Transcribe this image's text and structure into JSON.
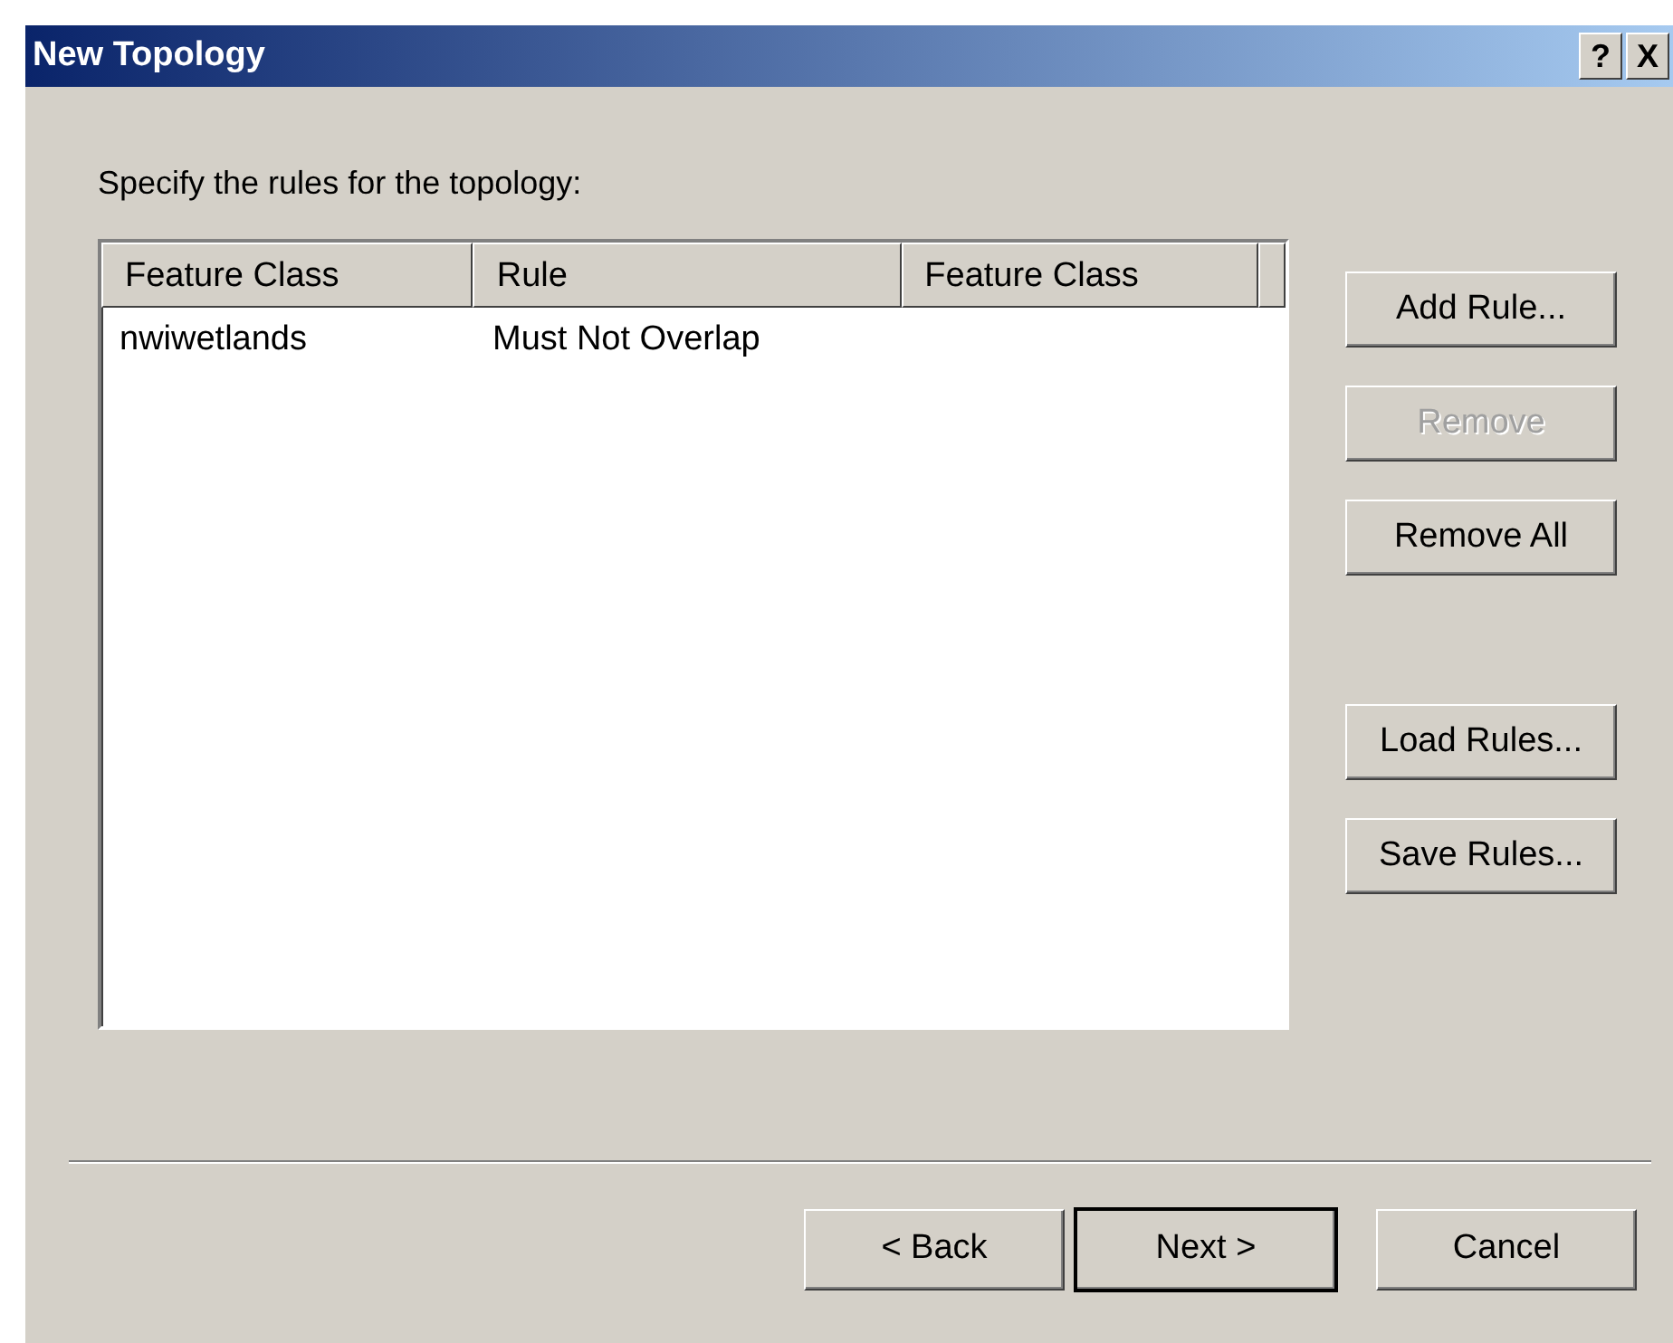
{
  "window": {
    "title": "New Topology",
    "title_buttons": [
      {
        "label": "?"
      },
      {
        "label": "X"
      }
    ]
  },
  "instruction": "Specify the rules for the topology:",
  "table": {
    "columns": [
      "Feature Class",
      "Rule",
      "Feature Class"
    ],
    "rows": [
      {
        "cells": [
          "nwiwetlands",
          "Must Not Overlap",
          ""
        ]
      }
    ]
  },
  "side_buttons": [
    {
      "label": "Add Rule...",
      "disabled": false
    },
    {
      "label": "Remove",
      "disabled": true
    },
    {
      "label": "Remove All",
      "disabled": false
    },
    {
      "label": "Load Rules...",
      "disabled": false
    },
    {
      "label": "Save Rules...",
      "disabled": false
    }
  ],
  "nav_buttons": [
    {
      "label": "< Back",
      "default": false
    },
    {
      "label": "Next >",
      "default": true
    },
    {
      "label": "Cancel",
      "default": false
    }
  ]
}
